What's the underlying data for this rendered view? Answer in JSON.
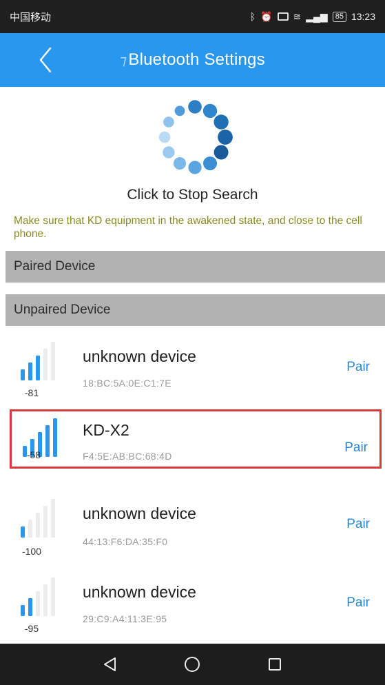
{
  "status_bar": {
    "carrier": "中国移动",
    "time": "13:23",
    "battery": "85"
  },
  "app_bar": {
    "title": "Bluetooth Settings",
    "back_icon": "chevron-left-icon",
    "accent": "#2a97ee"
  },
  "search": {
    "stop_label": "Click to Stop Search",
    "spinner_icon": "loading-spinner-icon"
  },
  "hint": "Make sure that KD equipment in the awakened state, and close to the cell phone.",
  "sections": {
    "paired": "Paired Device",
    "unpaired": "Unpaired Device"
  },
  "devices": [
    {
      "name": "unknown device",
      "mac": "18:BC:5A:0E:C1:7E",
      "rssi": "-81",
      "signal_bars": 3,
      "action": "Pair"
    },
    {
      "name": "KD-X2",
      "mac": "F4:5E:AB:BC:68:4D",
      "rssi": "-58",
      "signal_bars": 5,
      "action": "Pair"
    },
    {
      "name": "unknown device",
      "mac": "44:13:F6:DA:35:F0",
      "rssi": "-100",
      "signal_bars": 1,
      "action": "Pair"
    },
    {
      "name": "unknown device",
      "mac": "29:C9:A4:11:3E:95",
      "rssi": "-95",
      "signal_bars": 2,
      "action": "Pair"
    }
  ],
  "nav": {
    "back": "triangle-back-icon",
    "home": "circle-home-icon",
    "recents": "square-recents-icon"
  },
  "colors": {
    "highlight_border": "#d83a3a",
    "signal_bar": "#2a97ee",
    "pair_text": "#2a87d6",
    "hint_text": "#8a8a25"
  }
}
